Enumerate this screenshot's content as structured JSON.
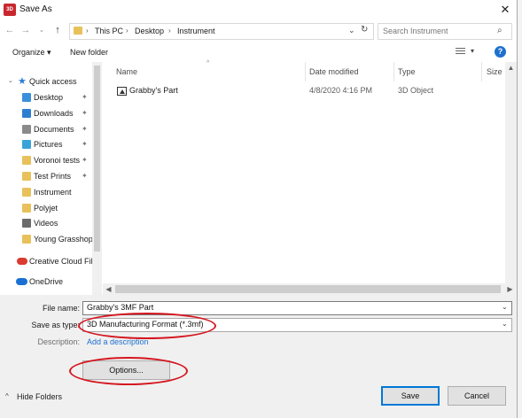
{
  "window": {
    "title": "Save As",
    "app_tile_text": "3D"
  },
  "address": {
    "crumbs": [
      "This PC",
      "Desktop",
      "Instrument"
    ],
    "search_placeholder": "Search Instrument"
  },
  "toolbar": {
    "organize": "Organize ▾",
    "new_folder": "New folder"
  },
  "sidebar": {
    "quick_access": "Quick access",
    "items": [
      {
        "label": "Desktop",
        "pinned": true,
        "color": "#3b8edb"
      },
      {
        "label": "Downloads",
        "pinned": true,
        "color": "#2d7fd1"
      },
      {
        "label": "Documents",
        "pinned": true,
        "color": "#8a8a8a"
      },
      {
        "label": "Pictures",
        "pinned": true,
        "color": "#3aa3d9"
      },
      {
        "label": "Voronoi tests",
        "pinned": true,
        "color": "#e8c15a"
      },
      {
        "label": "Test Prints",
        "pinned": true,
        "color": "#e8c15a"
      },
      {
        "label": "Instrument",
        "pinned": false,
        "color": "#e8c15a"
      },
      {
        "label": "Polyjet",
        "pinned": false,
        "color": "#e8c15a"
      },
      {
        "label": "Videos",
        "pinned": false,
        "color": "#6b6b6b"
      },
      {
        "label": "Young Grasshop",
        "pinned": false,
        "color": "#e8c15a"
      }
    ],
    "creative_cloud": "Creative Cloud File",
    "onedrive": "OneDrive",
    "pin_glyph": "✦"
  },
  "files": {
    "columns": [
      "Name",
      "Date modified",
      "Type",
      "Size"
    ],
    "rows": [
      {
        "name": "Grabby's Part",
        "date": "4/8/2020 4:16 PM",
        "type": "3D Object",
        "size": ""
      }
    ]
  },
  "form": {
    "file_name_label": "File name:",
    "file_name_value": "Grabby's 3MF Part",
    "save_type_label": "Save as type:",
    "save_type_value": "3D Manufacturing Format (*.3mf)",
    "description_label": "Description:",
    "add_description": "Add a description",
    "options_button": "Options...",
    "hide_folders": "Hide Folders",
    "save_button": "Save",
    "cancel_button": "Cancel"
  },
  "annotation_color": "#d5161f"
}
